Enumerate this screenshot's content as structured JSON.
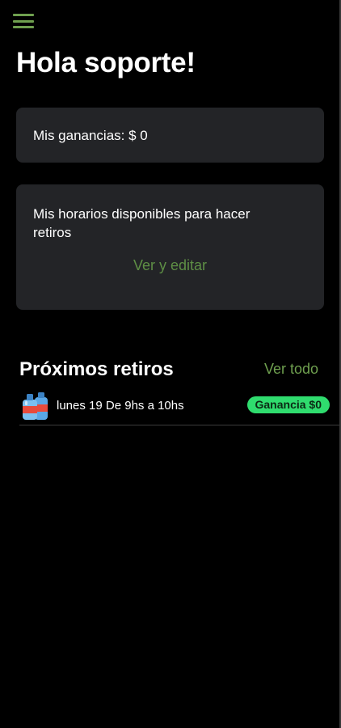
{
  "header": {
    "menu_icon": "hamburger-menu-icon",
    "greeting": "Hola soporte!"
  },
  "earnings_card": {
    "text": "Mis ganancias: $ 0"
  },
  "schedule_card": {
    "text": "Mis horarios disponibles para hacer retiros",
    "link_label": "Ver y editar"
  },
  "upcoming": {
    "title": "Próximos retiros",
    "see_all_label": "Ver todo",
    "items": [
      {
        "icon": "water-bottles-icon",
        "text": "lunes 19 De 9hs a 10hs",
        "badge": "Ganancia $0"
      }
    ]
  },
  "colors": {
    "background": "#000000",
    "card": "#232427",
    "accent_green": "#6fa04f",
    "badge_green": "#2fdc6e"
  }
}
